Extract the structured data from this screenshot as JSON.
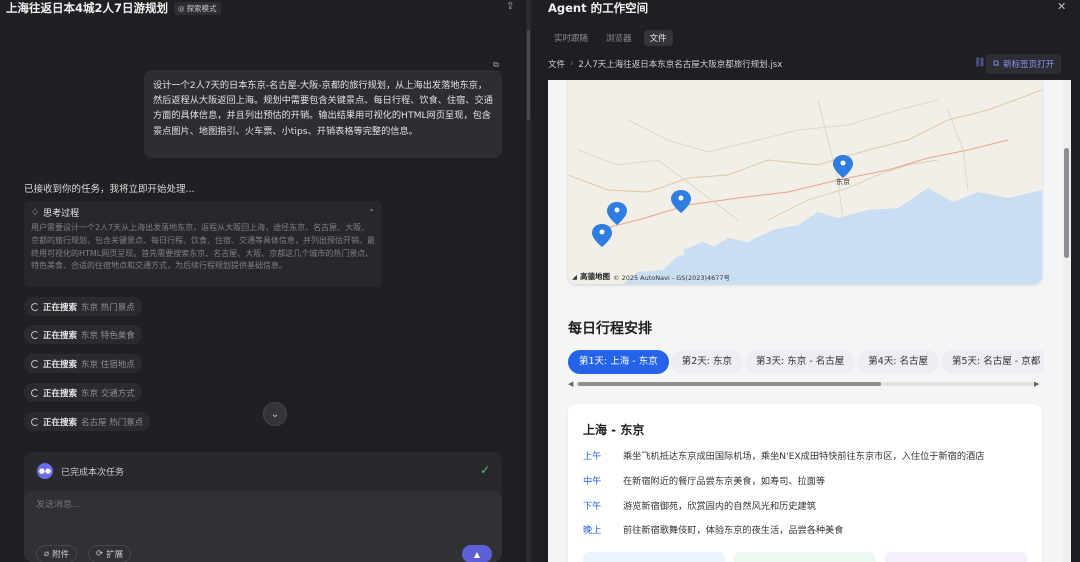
{
  "left": {
    "title": "上海往返日本4城2人7日游规划",
    "mode_badge": "探索模式",
    "user_message": "设计一个2人7天的日本东京-名古屋-大阪-京都的旅行规划，从上海出发落地东京，然后返程从大阪返回上海。规划中需要包含关键景点、每日行程、饮食、住宿、交通方面的具体信息，并且列出预估的开销。输出结果用可视化的HTML网页呈现，包含景点图片、地图指引、火车票、小tips、开销表格等完整的信息。",
    "ack": "已接收到你的任务，我将立即开始处理...",
    "thinking": {
      "title": "思考过程",
      "body": "用户需要设计一个2人7天从上海出发落地东京，返程从大阪回上海，途径东京、名古屋、大阪、京都的旅行规划，包含关键景点、每日行程、饮食、住宿、交通等具体信息，并列出预估开销，最终用可视化的HTML网页呈现。首先需要搜索东京、名古屋、大阪、京都这几个城市的热门景点、特色美食、合适的住宿地点和交通方式，为后续行程规划提供基础信息。"
    },
    "searches": [
      {
        "label": "正在搜索",
        "query": "东京 热门景点"
      },
      {
        "label": "正在搜索",
        "query": "东京 特色美食"
      },
      {
        "label": "正在搜索",
        "query": "东京 住宿地点"
      },
      {
        "label": "正在搜索",
        "query": "东京 交通方式"
      },
      {
        "label": "正在搜索",
        "query": "名古屋 热门景点"
      }
    ],
    "task_done": "已完成本次任务",
    "input_placeholder": "发送消息...",
    "attach_label": "附件",
    "extend_label": "扩展"
  },
  "right": {
    "title": "Agent 的工作空间",
    "tabs": [
      {
        "label": "实时跟随"
      },
      {
        "label": "浏览器"
      },
      {
        "label": "文件"
      }
    ],
    "breadcrumb": {
      "root": "文件",
      "file": "2人7天上海往返日本东京名古屋大阪京都旅行规划.jsx"
    },
    "open_tab_label": "新标签页打开",
    "map": {
      "city_label": "东京",
      "logo": "高德地图",
      "credit": "© 2025 AutoNavi - GS(2023)4677号"
    },
    "section_title": "每日行程安排",
    "day_tabs": [
      {
        "label": "第1天: 上海 - 东京"
      },
      {
        "label": "第2天: 东京"
      },
      {
        "label": "第3天: 东京 - 名古屋"
      },
      {
        "label": "第4天: 名古屋"
      },
      {
        "label": "第5天: 名古屋 - 京都"
      }
    ],
    "day_card": {
      "title": "上海 - 东京",
      "rows": [
        {
          "time": "上午",
          "activity": "乘坐飞机抵达东京成田国际机场，乘坐N'EX成田特快前往东京市区，入住位于新宿的酒店"
        },
        {
          "time": "中午",
          "activity": "在新宿附近的餐厅品尝东京美食，如寿司、拉面等"
        },
        {
          "time": "下午",
          "activity": "游览新宿御苑，欣赏园内的自然风光和历史建筑"
        },
        {
          "time": "晚上",
          "activity": "前往新宿歌舞伎町，体验东京的夜生活，品尝各种美食"
        }
      ]
    },
    "colors": {
      "accent": "#2563eb",
      "pin": "#2f7de1"
    }
  }
}
